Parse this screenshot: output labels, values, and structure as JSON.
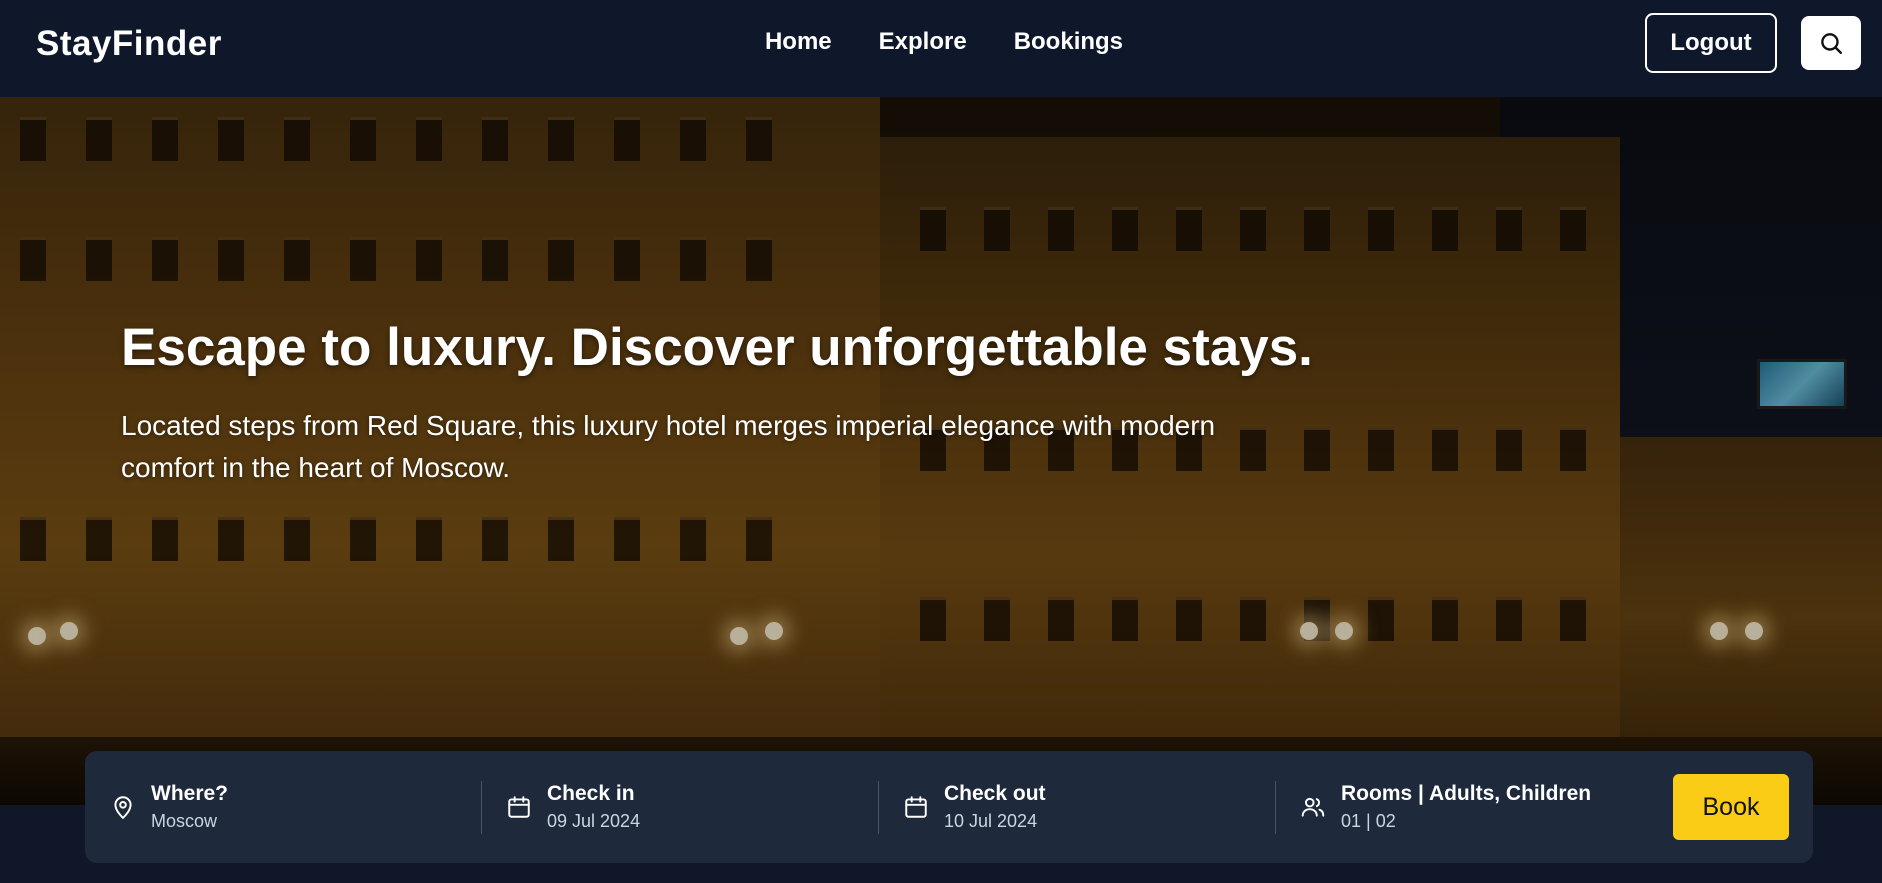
{
  "header": {
    "brand": "StayFinder",
    "nav": [
      {
        "label": "Home"
      },
      {
        "label": "Explore"
      },
      {
        "label": "Bookings"
      }
    ],
    "logout_label": "Logout",
    "search_icon": "search-icon"
  },
  "hero": {
    "title": "Escape to luxury. Discover unforgettable stays.",
    "subtitle": "Located steps from Red Square, this luxury hotel merges imperial elegance with modern comfort in the heart of Moscow."
  },
  "booking": {
    "where": {
      "label": "Where?",
      "value": "Moscow",
      "icon": "map-pin-icon"
    },
    "check_in": {
      "label": "Check in",
      "value": "09 Jul 2024",
      "icon": "calendar-icon"
    },
    "check_out": {
      "label": "Check out",
      "value": "10 Jul 2024",
      "icon": "calendar-icon"
    },
    "guests": {
      "label": "Rooms | Adults, Children",
      "value": "01 | 02",
      "icon": "users-icon"
    },
    "book_label": "Book"
  },
  "colors": {
    "header_bg": "#0f172a",
    "booking_bg": "#1e293b",
    "accent": "#facc15"
  }
}
